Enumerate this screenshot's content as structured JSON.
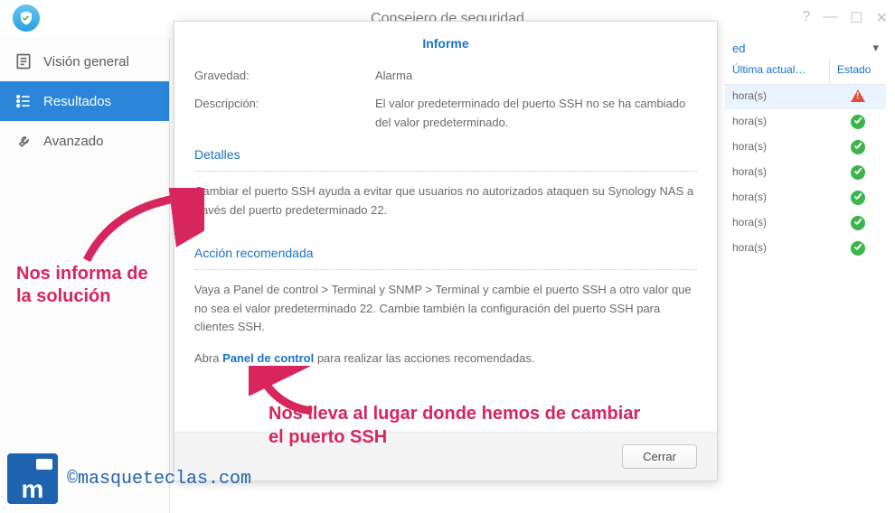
{
  "window": {
    "title": "Consejero de seguridad"
  },
  "sidebar": {
    "items": [
      {
        "label": "Visión general"
      },
      {
        "label": "Resultados"
      },
      {
        "label": "Avanzado"
      }
    ]
  },
  "red_dropdown": {
    "partial_label": "ed"
  },
  "results_table": {
    "headers": {
      "last_update": "Última actual…",
      "status": "Estado"
    },
    "rows": [
      {
        "time": "hora(s)",
        "status": "alarm"
      },
      {
        "time": "hora(s)",
        "status": "ok"
      },
      {
        "time": "hora(s)",
        "status": "ok"
      },
      {
        "time": "hora(s)",
        "status": "ok"
      },
      {
        "time": "hora(s)",
        "status": "ok"
      },
      {
        "time": "hora(s)",
        "status": "ok"
      },
      {
        "time": "hora(s)",
        "status": "ok"
      }
    ]
  },
  "modal": {
    "title": "Informe",
    "severity_label": "Gravedad:",
    "severity_value": "Alarma",
    "description_label": "Descripción:",
    "description_value": "El valor predeterminado del puerto SSH no se ha cambiado del valor predeterminado.",
    "details_title": "Detalles",
    "details_text": "Cambiar el puerto SSH ayuda a evitar que usuarios no autorizados ataquen su Synology NAS a través del puerto predeterminado 22.",
    "action_title": "Acción recomendada",
    "action_text": "Vaya a Panel de control > Terminal y SNMP > Terminal y cambie el puerto SSH a otro valor que no sea el valor predeterminado 22. Cambie también la configuración del puerto SSH para clientes SSH.",
    "open_prefix": "Abra ",
    "open_link": "Panel de control",
    "open_suffix": " para realizar las acciones recomendadas.",
    "close_button": "Cerrar"
  },
  "annotations": {
    "anno1": "Nos informa de la solución",
    "anno2": "Nos lleva al lugar donde hemos de cambiar el puerto SSH"
  },
  "watermark": {
    "text": "©masqueteclas.com",
    "badge": "m"
  }
}
